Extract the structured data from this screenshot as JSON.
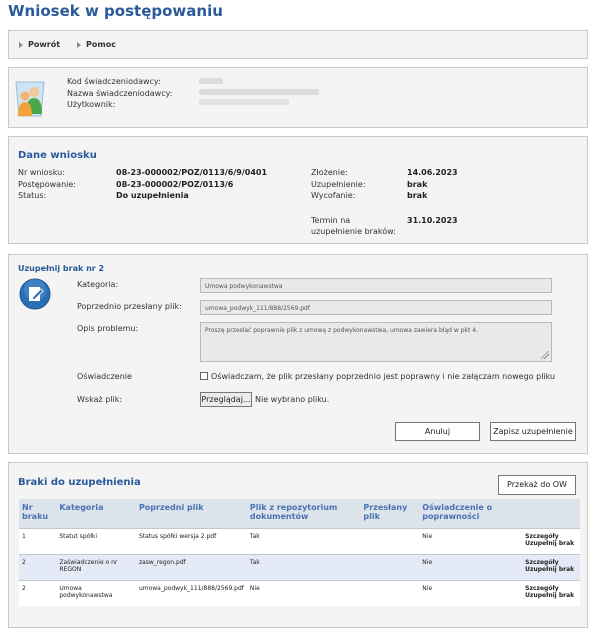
{
  "page": {
    "title": "Wniosek w postępowaniu"
  },
  "toolbar": {
    "back_label": "Powrót",
    "help_label": "Pomoc"
  },
  "user": {
    "code_label": "Kod świadczeniodawcy:",
    "name_label": "Nazwa świadczeniodawcy:",
    "user_label": "Użytkownik:",
    "icon": "users-icon"
  },
  "application": {
    "header": "Dane wniosku",
    "number_label": "Nr wniosku:",
    "number": "08-23-000002/POZ/0113/6/9/0401",
    "proceeding_label": "Postępowanie:",
    "proceeding": "08-23-000002/POZ/0113/6",
    "status_label": "Status:",
    "status": "Do uzupełnienia",
    "submitted_label": "Złożenie:",
    "submitted": "14.06.2023",
    "supplemented_label": "Uzupełnienie:",
    "supplemented": "brak",
    "withdrawn_label": "Wycofanie:",
    "withdrawn": "brak",
    "deadline_label_1": "Termin na",
    "deadline_label_2": "uzupełnienie braków:",
    "deadline": "31.10.2023"
  },
  "fill": {
    "header": "Uzupełnij brak nr 2",
    "icon": "document-edit-icon",
    "category_label": "Kategoria:",
    "category_value": "Umowa podwykonawstwa",
    "prev_file_label": "Poprzednio przesłany plik:",
    "prev_file_value": "umowa_podwyk_111/888/2569.pdf",
    "problem_label": "Opis problemu:",
    "problem_value": "Proszę  przesłać poprawnie plik z umową z podwykonawstwa, umowa zawiera błąd w pkt 4.",
    "statement_label": "Oświadczenie",
    "statement_text": "Oświadczam, że plik przesłany poprzednio jest poprawny i nie załączam nowego pliku",
    "file_label": "Wskaż plik:",
    "browse_label": "Przeglądaj...",
    "no_file_text": "Nie wybrano pliku.",
    "cancel_label": "Anuluj",
    "save_label": "Zapisz uzupełnienie"
  },
  "deficiencies": {
    "header": "Braki do uzupełnienia",
    "submit_label": "Przekaż do OW",
    "columns": {
      "nr": "Nr braku",
      "category": "Kategoria",
      "prev_file": "Poprzedni plik",
      "repo_file": "Plik z repozytorium dokumentów",
      "sent_file": "Przesłany plik",
      "statement": "Oświadczenie o poprawności"
    },
    "rows": [
      {
        "nr": "1",
        "category": "Statut spółki",
        "prev_file": "Status spółki wersja 2.pdf",
        "repo": "Tak",
        "sent": "",
        "statement": "Nie",
        "details": "Szczegóły",
        "fill": "Uzupełnij brak"
      },
      {
        "nr": "2",
        "category": "Zaświadczenie o nr REGON",
        "prev_file": "zasw_regon.pdf",
        "repo": "Tak",
        "sent": "",
        "statement": "Nie",
        "details": "Szczegóły",
        "fill": "Uzupełnij brak"
      },
      {
        "nr": "2",
        "category": "Umowa podwykonawstwa",
        "prev_file": "umowa_podwyk_111/888/2569.pdf",
        "repo": "Nie",
        "sent": "",
        "statement": "Nie",
        "details": "Szczegóły",
        "fill": "Uzupełnij brak"
      }
    ]
  }
}
